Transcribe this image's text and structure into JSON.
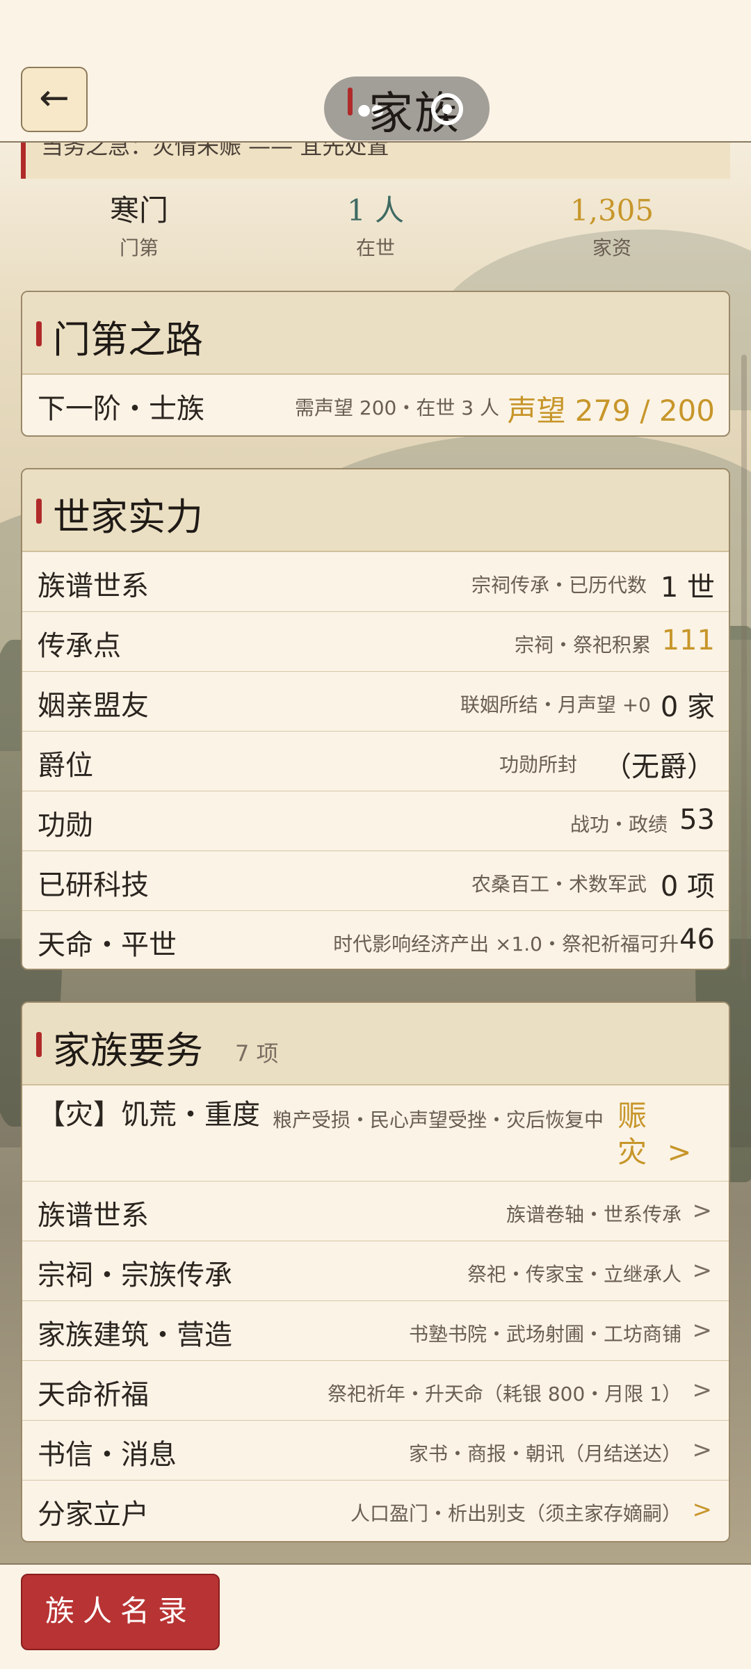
{
  "header": {
    "back_icon": "←",
    "title": "家族"
  },
  "alert": {
    "text": "当务之急：灾情未赈 —— 宜先处置"
  },
  "stats": [
    {
      "value": "寒门",
      "label": "门第"
    },
    {
      "value": "1 人",
      "label": "在世"
    },
    {
      "value": "1,305",
      "label": "家资"
    }
  ],
  "road": {
    "title": "门第之路",
    "row": {
      "name": "下一阶・士族",
      "desc": "需声望 200・在世 3 人",
      "value": "声望 279 / 200"
    }
  },
  "power": {
    "title": "世家实力",
    "rows": [
      {
        "name": "族谱世系",
        "desc": "宗祠传承・已历代数",
        "value": "1 世"
      },
      {
        "name": "传承点",
        "desc": "宗祠・祭祀积累",
        "value": "111"
      },
      {
        "name": "姻亲盟友",
        "desc": "联姻所结・月声望 +0",
        "value": "0 家"
      },
      {
        "name": "爵位",
        "desc": "功勋所封",
        "value": "（无爵）"
      },
      {
        "name": "功勋",
        "desc": "战功・政绩",
        "value": "53"
      },
      {
        "name": "已研科技",
        "desc": "农桑百工・术数军武",
        "value": "0 项"
      },
      {
        "name": "天命・平世",
        "desc": "时代影响经济产出 ×1.0・祭祀祈福可升",
        "value": "46"
      }
    ]
  },
  "tasks": {
    "title": "家族要务",
    "count": "7 项",
    "urgent": {
      "name": "【灾】饥荒・重度",
      "desc": "粮产受损・民心声望受挫・灾后恢复中",
      "action": "赈 灾 >"
    },
    "rows": [
      {
        "name": "族谱世系",
        "desc": "族谱卷轴・世系传承"
      },
      {
        "name": "宗祠・宗族传承",
        "desc": "祭祀・传家宝・立继承人"
      },
      {
        "name": "家族建筑・营造",
        "desc": "书塾书院・武场射圃・工坊商铺"
      },
      {
        "name": "天命祈福",
        "desc": "祭祀祈年・升天命（耗银 800・月限 1）"
      },
      {
        "name": "书信・消息",
        "desc": "家书・商报・朝讯（月结送达）"
      },
      {
        "name": "分家立户",
        "desc": "人口盈门・析出别支（须主家存嫡嗣）"
      }
    ],
    "chevron": ">"
  },
  "bottom": {
    "roster_button": "族人名录"
  },
  "colors": {
    "accent_red": "#b02a2a",
    "gold": "#c7962a",
    "teal": "#3e6a62",
    "paper": "#fbf3e6"
  }
}
